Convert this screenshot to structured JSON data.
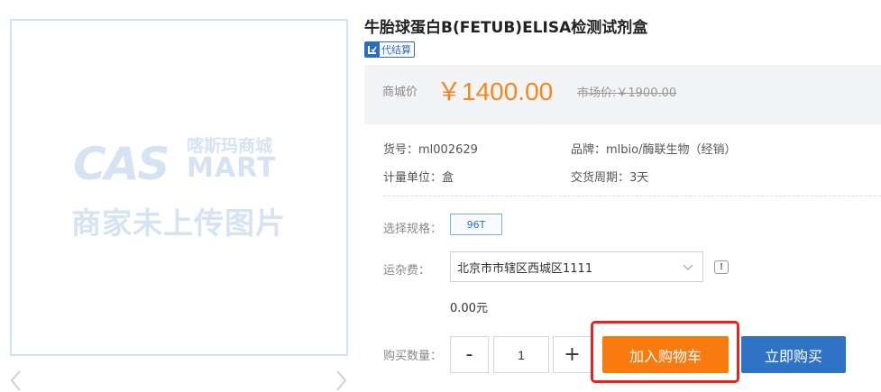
{
  "image_placeholder": {
    "logo_cas": "CAS",
    "logo_cn": "喀斯玛商城",
    "logo_mart": "MART",
    "note": "商家未上传图片"
  },
  "product": {
    "title": "牛胎球蛋白B(FETUB)ELISA检测试剂盒",
    "badge": "代结算"
  },
  "price": {
    "label": "商城价",
    "value": "￥1400.00",
    "market": "市场价:￥1900.00"
  },
  "info": {
    "sku": "货号：ml002629",
    "brand": "品牌：mlbio/酶联生物（经销）",
    "unit": "计量单位：盒",
    "delivery": "交货周期：3天"
  },
  "spec": {
    "label": "选择规格：",
    "option": "96T"
  },
  "freight": {
    "label": "运杂费：",
    "address": "北京市市辖区西城区1111",
    "value": "0.00元"
  },
  "quantity": {
    "label": "购买数量：",
    "minus": "-",
    "value": "1",
    "plus": "+"
  },
  "actions": {
    "add_to_cart": "加入购物车",
    "buy_now": "立即购买"
  },
  "colors": {
    "price": "#f7861e",
    "cart_button": "#f97b10",
    "buy_button": "#2f74c4",
    "highlight": "#e8231b"
  }
}
